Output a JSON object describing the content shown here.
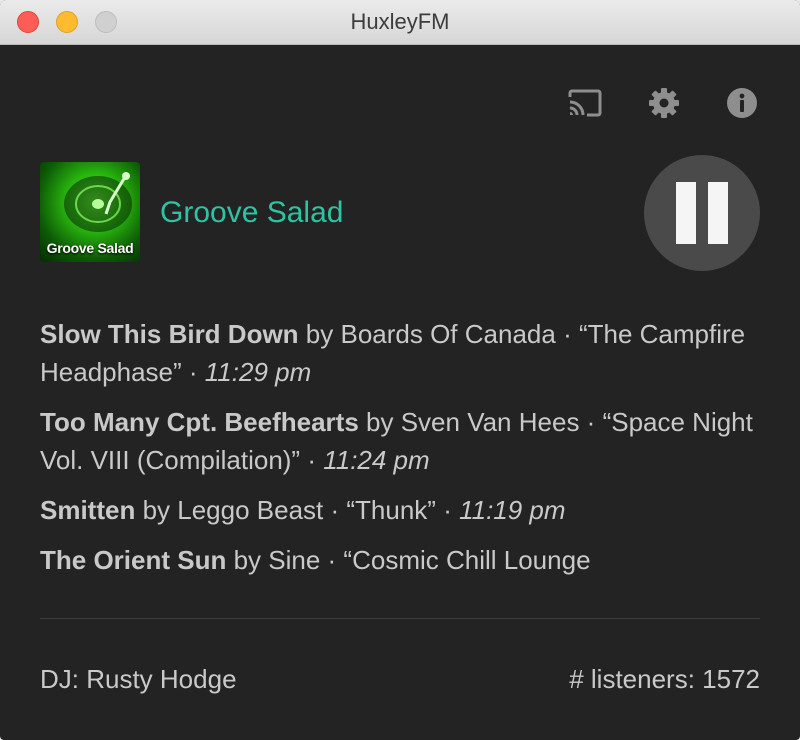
{
  "window": {
    "title": "HuxleyFM"
  },
  "toolbar": {
    "icons": [
      "cast-icon",
      "gear-icon",
      "info-icon"
    ]
  },
  "station": {
    "name": "Groove Salad",
    "art_text": "Groove Salad",
    "name_color": "#2dc3a3"
  },
  "player": {
    "state": "playing",
    "control": "pause"
  },
  "tracks": [
    {
      "title": "Slow This Bird Down",
      "by": " by ",
      "artist": "Boards Of Canada",
      "album_sep": " · ",
      "album": "“The Campfire Headphase”",
      "time_sep": " · ",
      "time": "11:29 pm"
    },
    {
      "title": "Too Many Cpt. Beefhearts",
      "by": " by ",
      "artist": "Sven Van Hees",
      "album_sep": " · ",
      "album": "“Space Night Vol. VIII (Compilation)”",
      "time_sep": " · ",
      "time": "11:24 pm"
    },
    {
      "title": "Smitten",
      "by": " by ",
      "artist": "Leggo Beast",
      "album_sep": " · ",
      "album": "“Thunk”",
      "time_sep": " · ",
      "time": "11:19 pm"
    },
    {
      "title": "The Orient Sun",
      "by": " by ",
      "artist": "Sine",
      "album_sep": " · ",
      "album": "“Cosmic Chill Lounge",
      "time_sep": "",
      "time": ""
    }
  ],
  "footer": {
    "dj": "DJ: Rusty Hodge",
    "listeners": "# listeners: 1572"
  }
}
